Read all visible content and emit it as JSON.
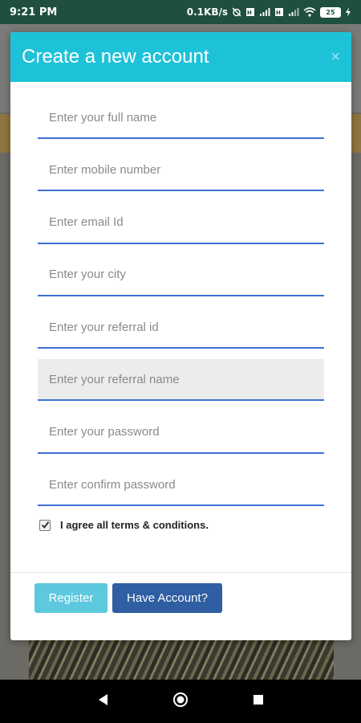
{
  "status_bar": {
    "time": "9:21 PM",
    "network_speed": "0.1KB/s",
    "battery": "25"
  },
  "modal": {
    "title": "Create a new account",
    "close_label": "×"
  },
  "form": {
    "fields": [
      {
        "placeholder": "Enter your full name",
        "value": ""
      },
      {
        "placeholder": "Enter mobile number",
        "value": ""
      },
      {
        "placeholder": "Enter email Id",
        "value": ""
      },
      {
        "placeholder": "Enter your city",
        "value": ""
      },
      {
        "placeholder": "Enter your referral id",
        "value": ""
      },
      {
        "placeholder": "Enter your referral name",
        "value": "",
        "disabled": true
      },
      {
        "placeholder": "Enter your password",
        "value": ""
      },
      {
        "placeholder": "Enter confirm password",
        "value": ""
      }
    ],
    "terms_label": "I agree all terms & conditions.",
    "terms_checked": true
  },
  "footer": {
    "register_label": "Register",
    "have_account_label": "Have Account?"
  },
  "colors": {
    "header": "#1ec2d8",
    "register_button": "#5cc9de",
    "have_account_button": "#2f5ea2",
    "field_underline": "#3d72d4"
  }
}
